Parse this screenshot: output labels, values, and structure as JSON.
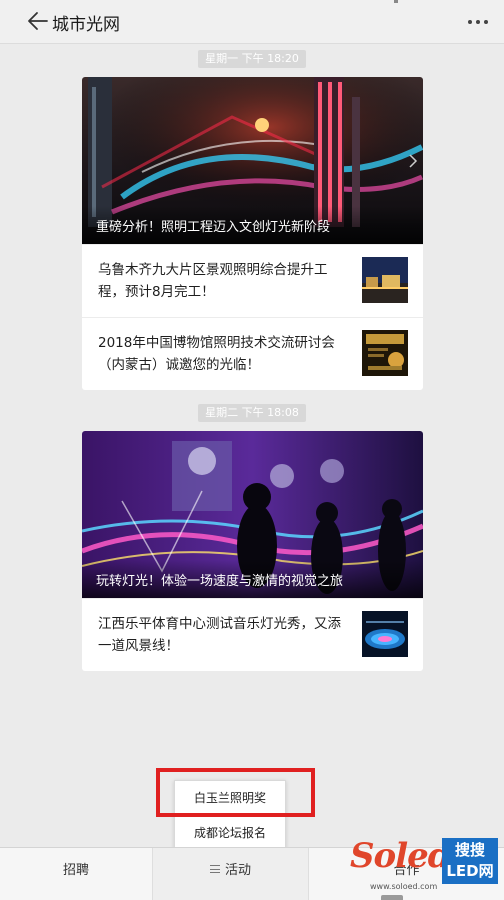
{
  "header": {
    "title": "城市光网"
  },
  "feed": [
    {
      "time_label": "星期一 下午 18:20",
      "hero_caption": "重磅分析！照明工程迈入文创灯光新阶段",
      "items": [
        {
          "text": "乌鲁木齐九大片区景观照明综合提升工程，预计8月完工！"
        },
        {
          "text": "2018年中国博物馆照明技术交流研讨会（内蒙古）诚邀您的光临！"
        }
      ]
    },
    {
      "time_label": "星期二 下午 18:08",
      "hero_caption": "玩转灯光！体验一场速度与激情的视觉之旅",
      "items": [
        {
          "text": "江西乐平体育中心测试音乐灯光秀，又添一道风景线！"
        }
      ]
    }
  ],
  "popup_menu": {
    "items": [
      "白玉兰照明奖",
      "成都论坛报名"
    ]
  },
  "bottom_tabs": [
    {
      "label": "招聘"
    },
    {
      "label": "活动",
      "icon": "menu-icon"
    },
    {
      "label": "合作"
    }
  ],
  "watermark": {
    "logo": "Soled",
    "badge_line1": "搜搜",
    "badge_line2": "LED网",
    "url": "www.soloed.com"
  },
  "colors": {
    "highlight": "#e02020",
    "background": "#ebebeb",
    "watermark_red": "#e0462b",
    "watermark_blue": "#1a6fc4"
  }
}
